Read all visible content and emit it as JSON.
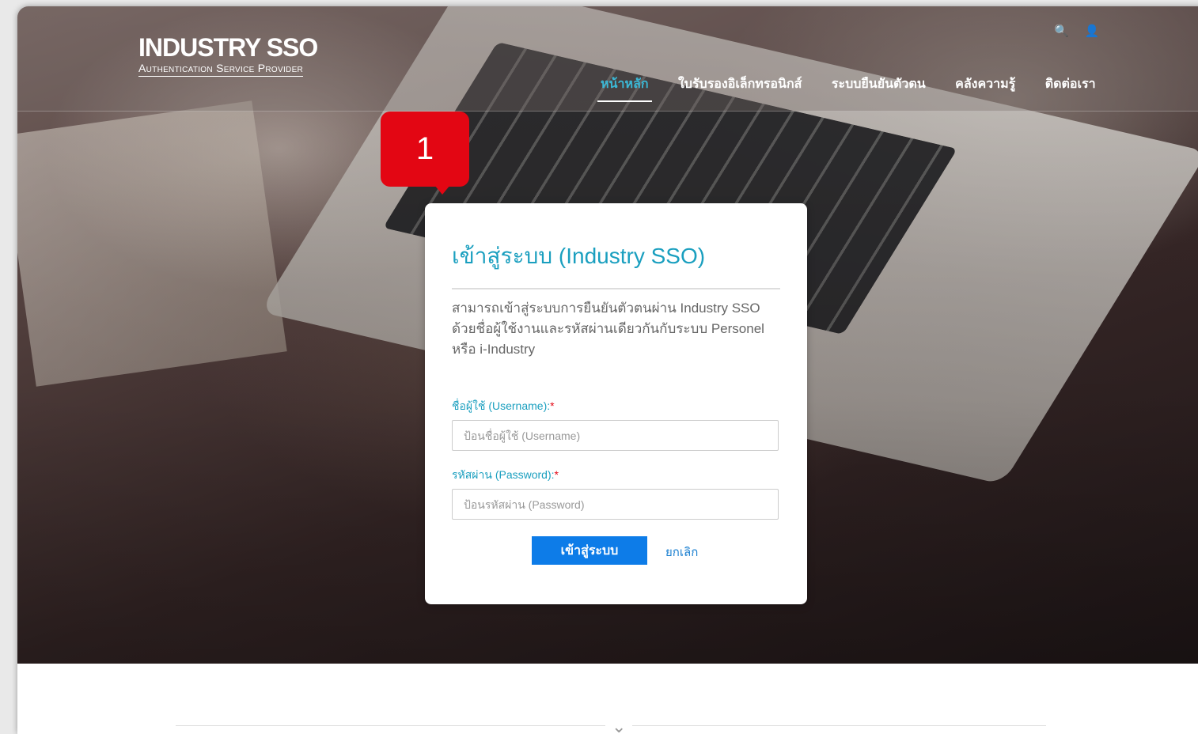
{
  "logo": {
    "title": "INDUSTRY SSO",
    "subtitle": "Authentication Service Provider"
  },
  "top_icons": [
    {
      "name": "search-icon",
      "glyph": "🔍"
    },
    {
      "name": "user-icon",
      "glyph": "👤"
    }
  ],
  "nav": {
    "items": [
      {
        "label": "หน้าหลัก",
        "active": true
      },
      {
        "label": "ใบรับรองอิเล็กทรอนิกส์",
        "active": false
      },
      {
        "label": "ระบบยืนยันตัวตน",
        "active": false
      },
      {
        "label": "คลังความรู้",
        "active": false
      },
      {
        "label": "ติดต่อเรา",
        "active": false
      }
    ]
  },
  "callout": {
    "number": "1"
  },
  "login": {
    "title": "เข้าสู่ระบบ (Industry SSO)",
    "description": "สามารถเข้าสู่ระบบการยืนยันตัวตนผ่าน Industry SSO ด้วยชื่อผู้ใช้งานและรหัสผ่านเดียวกันกับระบบ Personel หรือ i-Industry",
    "username_label": "ชื่อผู้ใช้ (Username):",
    "username_placeholder": "ป้อนชื่อผู้ใช้ (Username)",
    "password_label": "รหัสผ่าน (Password):",
    "password_placeholder": "ป้อนรหัสผ่าน (Password)",
    "required_mark": "*",
    "submit_label": "เข้าสู่ระบบ",
    "cancel_label": "ยกเลิก"
  },
  "footer": {
    "chevron": "⌄"
  },
  "colors": {
    "accent": "#1a9fbf",
    "button": "#0d7ce8",
    "callout": "#e30613"
  }
}
